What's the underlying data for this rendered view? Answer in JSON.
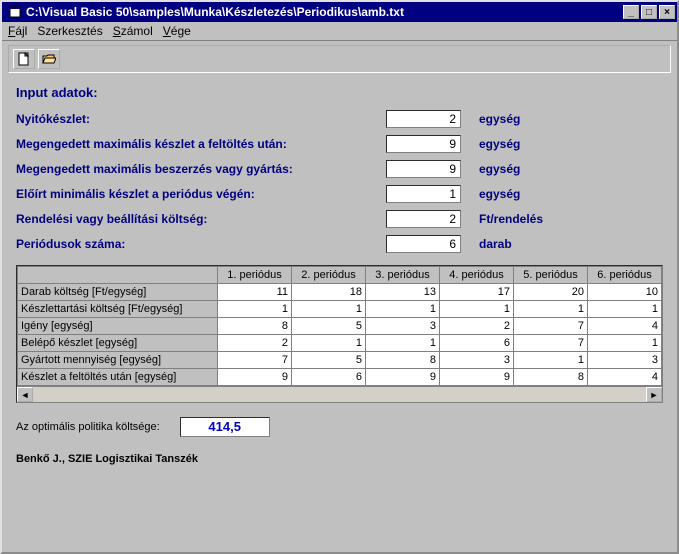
{
  "window": {
    "title": "C:\\Visual Basic 50\\samples\\Munka\\Készletezés\\Periodikus\\amb.txt"
  },
  "menu": {
    "file": "Fájl",
    "edit": "Szerkesztés",
    "calc": "Számol",
    "end": "Vége"
  },
  "section_title": "Input adatok:",
  "fields": {
    "opening_stock": {
      "label": "Nyitókészlet:",
      "value": "2",
      "unit": "egység"
    },
    "max_stock": {
      "label": "Megengedett maximális készlet a feltöltés után:",
      "value": "9",
      "unit": "egység"
    },
    "max_prod": {
      "label": "Megengedett maximális beszerzés vagy gyártás:",
      "value": "9",
      "unit": "egység"
    },
    "min_stock": {
      "label": "Előírt minimális készlet a periódus végén:",
      "value": "1",
      "unit": "egység"
    },
    "order_cost": {
      "label": "Rendelési vagy beállítási költség:",
      "value": "2",
      "unit": "Ft/rendelés"
    },
    "periods": {
      "label": "Periódusok száma:",
      "value": "6",
      "unit": "darab"
    }
  },
  "grid": {
    "cols": [
      "1. periódus",
      "2. periódus",
      "3. periódus",
      "4. periódus",
      "5. periódus",
      "6. periódus"
    ],
    "rows": [
      {
        "h": "Darab költség [Ft/egység]",
        "v": [
          "11",
          "18",
          "13",
          "17",
          "20",
          "10"
        ]
      },
      {
        "h": "Készlettartási költség [Ft/egység]",
        "v": [
          "1",
          "1",
          "1",
          "1",
          "1",
          "1"
        ]
      },
      {
        "h": "Igény [egység]",
        "v": [
          "8",
          "5",
          "3",
          "2",
          "7",
          "4"
        ]
      },
      {
        "h": "Belépő készlet [egység]",
        "v": [
          "2",
          "1",
          "1",
          "6",
          "7",
          "1"
        ]
      },
      {
        "h": "Gyártott mennyiség [egység]",
        "v": [
          "7",
          "5",
          "8",
          "3",
          "1",
          "3"
        ]
      },
      {
        "h": "Készlet a feltöltés után [egység]",
        "v": [
          "9",
          "6",
          "9",
          "9",
          "8",
          "4"
        ]
      }
    ]
  },
  "result": {
    "label": "Az optimális politika költsége:",
    "value": "414,5"
  },
  "footer": "Benkő J., SZIE Logisztikai Tanszék"
}
